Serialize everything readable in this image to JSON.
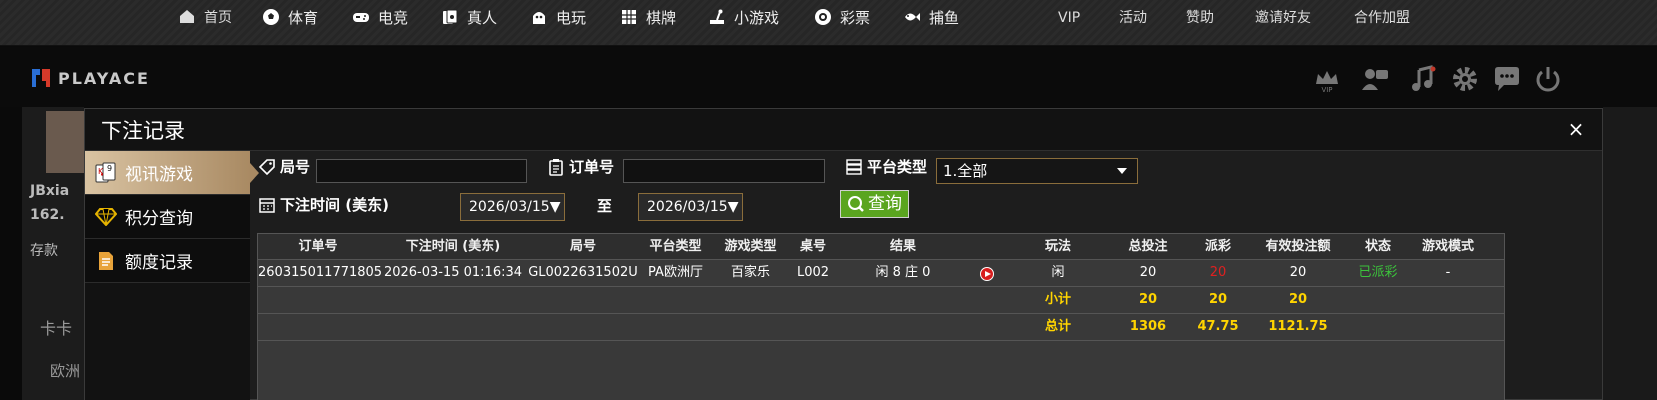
{
  "topnav": {
    "items": [
      {
        "label": "首页",
        "icon": "home-icon"
      },
      {
        "label": "体育",
        "icon": "soccer-ball-icon"
      },
      {
        "label": "电竞",
        "icon": "gamepad-icon"
      },
      {
        "label": "真人",
        "icon": "playing-cards-icon"
      },
      {
        "label": "电玩",
        "icon": "arcade-icon"
      },
      {
        "label": "棋牌",
        "icon": "grid-board-icon"
      },
      {
        "label": "小游戏",
        "icon": "joystick-icon"
      },
      {
        "label": "彩票",
        "icon": "lottery-ball-icon"
      },
      {
        "label": "捕鱼",
        "icon": "fish-icon"
      }
    ],
    "right_links": [
      "VIP",
      "活动",
      "赞助",
      "邀请好友",
      "合作加盟"
    ]
  },
  "header": {
    "logo_text": "PLAYACE",
    "icons": [
      "vip-crown-icon",
      "customer-service-icon",
      "music-icon",
      "settings-gear-icon",
      "chat-icon",
      "power-icon"
    ]
  },
  "background": {
    "user_name": "JBxia",
    "balance": "162.",
    "deposit": "存款",
    "row_a": "卡卡",
    "row_b": "欧洲"
  },
  "modal": {
    "title": "下注记录",
    "close": "×",
    "tabs": [
      {
        "label": "视讯游戏",
        "icon": "playing-cards-icon",
        "active": true
      },
      {
        "label": "积分查询",
        "icon": "diamond-icon",
        "active": false
      },
      {
        "label": "额度记录",
        "icon": "document-icon",
        "active": false
      }
    ],
    "filters": {
      "round_label": "局号",
      "round_value": "",
      "order_label": "订单号",
      "order_value": "",
      "platform_label": "平台类型",
      "platform_value": "1.全部",
      "time_label": "下注时间 (美东)",
      "date_from": "2026/03/15▼",
      "to_label": "至",
      "date_to": "2026/03/15▼",
      "query_button": "查询"
    },
    "table": {
      "headers": [
        "订单号",
        "下注时间 (美东)",
        "局号",
        "平台类型",
        "游戏类型",
        "桌号",
        "结果",
        "",
        "玩法",
        "总投注",
        "派彩",
        "有效投注额",
        "状态",
        "游戏模式"
      ],
      "rows": [
        [
          "260315011771805",
          "2026-03-15 01:16:34",
          "GL0022631502U",
          "PA欧洲厅",
          "百家乐",
          "L002",
          "闲 8 庄 0",
          "",
          "闲",
          "20",
          "20",
          "20",
          "已派彩",
          "-"
        ]
      ],
      "subtotal": {
        "label": "小计",
        "bet": "20",
        "payout": "20",
        "valid": "20"
      },
      "total": {
        "label": "总计",
        "bet": "1306",
        "payout": "47.75",
        "valid": "1121.75"
      }
    }
  },
  "colors": {
    "accent_gold": "#a98a63",
    "query_green": "#5aa51f",
    "total_yellow": "#ffd400",
    "status_green": "#3cc23c",
    "payout_red": "#e02020"
  }
}
